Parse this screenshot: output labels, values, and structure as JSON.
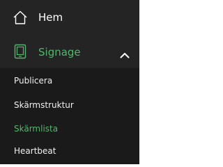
{
  "sidebar": {
    "home": {
      "label": "Hem",
      "icon": "home-icon"
    },
    "signage": {
      "label": "Signage",
      "icon": "tablet-icon",
      "expanded": true,
      "toggle_icon": "chevron-up-icon",
      "items": [
        {
          "label": "Publicera",
          "active": false
        },
        {
          "label": "Skärmstruktur",
          "active": false
        },
        {
          "label": "Skärmlista",
          "active": true
        },
        {
          "label": "Heartbeat",
          "active": false
        }
      ]
    }
  },
  "colors": {
    "sidebar_bg": "#242424",
    "submenu_bg": "#1a1a1a",
    "accent_green": "#55b56f",
    "text_white": "#ffffff",
    "page_bg": "#ffffff"
  }
}
